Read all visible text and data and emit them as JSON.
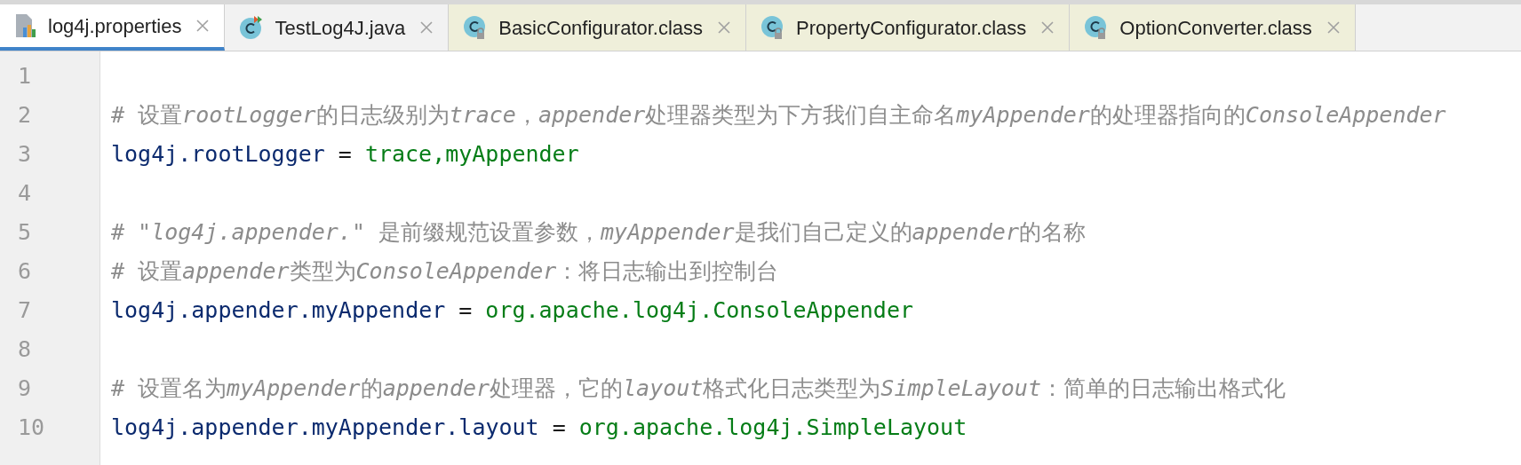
{
  "tabs": [
    {
      "label": "log4j.properties",
      "kind": "properties",
      "selected": true
    },
    {
      "label": "TestLog4J.java",
      "kind": "java",
      "selected": false
    },
    {
      "label": "BasicConfigurator.class",
      "kind": "class",
      "selected": false
    },
    {
      "label": "PropertyConfigurator.class",
      "kind": "class",
      "selected": false
    },
    {
      "label": "OptionConverter.class",
      "kind": "class",
      "selected": false
    }
  ],
  "editor": {
    "lines": [
      {
        "number": "1",
        "kind": "blank"
      },
      {
        "number": "2",
        "kind": "comment",
        "segments": [
          {
            "text": "# 设置",
            "italic": false
          },
          {
            "text": "rootLogger",
            "italic": true
          },
          {
            "text": "的日志级别为",
            "italic": false
          },
          {
            "text": "trace",
            "italic": true
          },
          {
            "text": "，",
            "italic": false
          },
          {
            "text": "appender",
            "italic": true
          },
          {
            "text": "处理器类型为下方我们自主命名",
            "italic": false
          },
          {
            "text": "myAppender",
            "italic": true
          },
          {
            "text": "的处理器指向的",
            "italic": false
          },
          {
            "text": "ConsoleAppender",
            "italic": true
          }
        ]
      },
      {
        "number": "3",
        "kind": "property",
        "key": "log4j.rootLogger",
        "separator": "=",
        "value": "trace,myAppender"
      },
      {
        "number": "4",
        "kind": "blank"
      },
      {
        "number": "5",
        "kind": "comment",
        "segments": [
          {
            "text": "# ",
            "italic": false
          },
          {
            "text": "\"log4j.appender.\"",
            "italic": true
          },
          {
            "text": " 是前缀规范设置参数，",
            "italic": false
          },
          {
            "text": "myAppender",
            "italic": true
          },
          {
            "text": "是我们自己定义的",
            "italic": false
          },
          {
            "text": "appender",
            "italic": true
          },
          {
            "text": "的名称",
            "italic": false
          }
        ]
      },
      {
        "number": "6",
        "kind": "comment",
        "segments": [
          {
            "text": "# 设置",
            "italic": false
          },
          {
            "text": "appender",
            "italic": true
          },
          {
            "text": "类型为",
            "italic": false
          },
          {
            "text": "ConsoleAppender",
            "italic": true
          },
          {
            "text": "：将日志输出到控制台",
            "italic": false
          }
        ]
      },
      {
        "number": "7",
        "kind": "property",
        "key": "log4j.appender.myAppender",
        "separator": "=",
        "value": "org.apache.log4j.ConsoleAppender"
      },
      {
        "number": "8",
        "kind": "blank"
      },
      {
        "number": "9",
        "kind": "comment",
        "segments": [
          {
            "text": "# 设置名为",
            "italic": false
          },
          {
            "text": "myAppender",
            "italic": true
          },
          {
            "text": "的",
            "italic": false
          },
          {
            "text": "appender",
            "italic": true
          },
          {
            "text": "处理器，它的",
            "italic": false
          },
          {
            "text": "layout",
            "italic": true
          },
          {
            "text": "格式化日志类型为",
            "italic": false
          },
          {
            "text": "SimpleLayout",
            "italic": true
          },
          {
            "text": "：简单的日志输出格式化",
            "italic": false
          }
        ]
      },
      {
        "number": "10",
        "kind": "property",
        "key": "log4j.appender.myAppender.layout",
        "separator": "=",
        "value": "org.apache.log4j.SimpleLayout"
      }
    ]
  }
}
